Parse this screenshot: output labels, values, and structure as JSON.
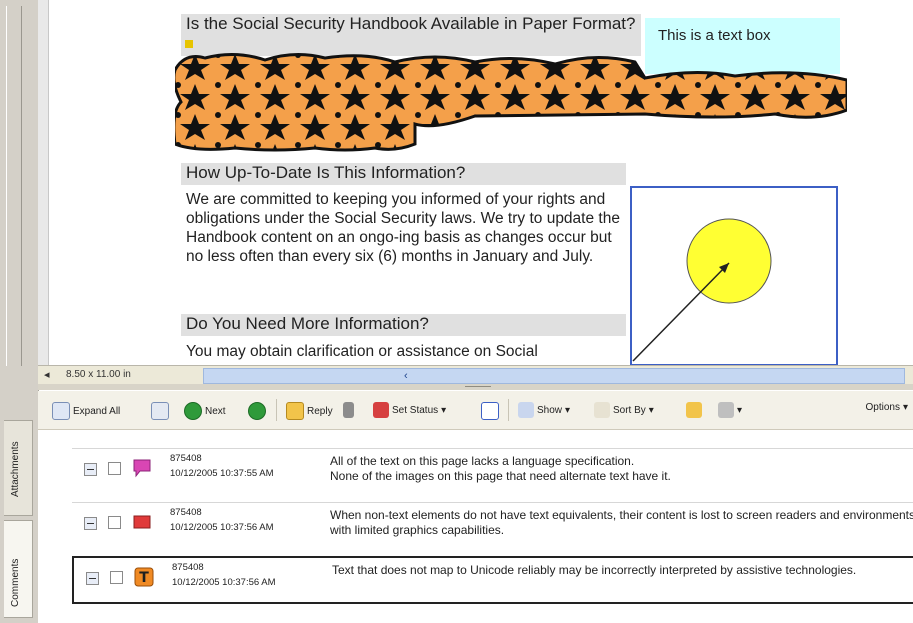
{
  "document": {
    "question_heading": "Is the Social Security Handbook Available in Paper Format?",
    "text_box": "This is a text box",
    "section1": {
      "heading": "How Up-To-Date Is This Information?",
      "body": "We are committed to keeping you informed of your rights and obligations under the Social Security laws. We try to update the Handbook content on an ongo-ing basis as changes occur but no less often than every six (6) months in January and July."
    },
    "section2": {
      "heading": "Do You Need More Information?",
      "body": "You may obtain clarification or assistance on Social"
    }
  },
  "status_bar": {
    "page_size": "8.50 x 11.00 in"
  },
  "comments_toolbar": {
    "expand_all": "Expand All",
    "next": "Next",
    "reply": "Reply",
    "set_status": "Set Status",
    "show": "Show",
    "sort_by": "Sort By",
    "options": "Options"
  },
  "side_tabs": {
    "attachments": "Attachments",
    "comments": "Comments"
  },
  "comments": [
    {
      "author": "875408",
      "date": "10/12/2005 10:37:55 AM",
      "icon": "speech-bubble-icon",
      "color": "#d946b4",
      "text": "All of the text on this page lacks a language specification.\nNone of the images on this page that need alternate text have it."
    },
    {
      "author": "875408",
      "date": "10/12/2005 10:37:56 AM",
      "icon": "rectangle-icon",
      "color": "#e03a3a",
      "text": "When non-text elements do not have text equivalents, their content is lost to screen readers and environments with limited graphics capabilities."
    },
    {
      "author": "875408",
      "date": "10/12/2005 10:37:56 AM",
      "icon": "text-annotation-icon",
      "color": "#f08a24",
      "text": "Text that does not map to Unicode reliably may be incorrectly interpreted by assistive technologies."
    }
  ],
  "colors": {
    "accent_blue": "#3c5fc5",
    "circle_yellow": "#ffff33",
    "textbox_cyan": "#ccffff"
  }
}
